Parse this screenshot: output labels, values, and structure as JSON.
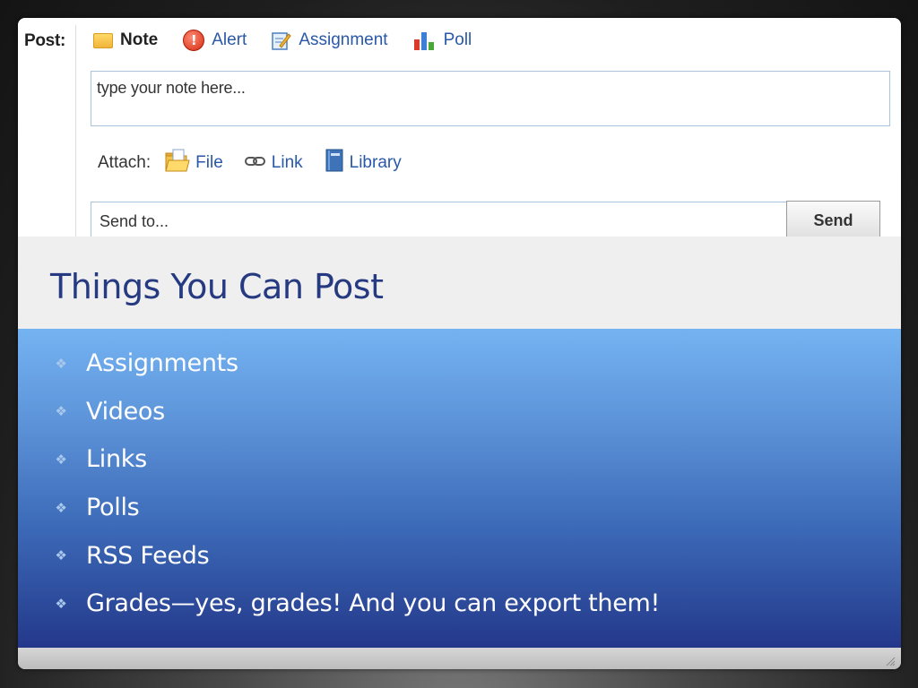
{
  "composer": {
    "post_label": "Post:",
    "types": [
      {
        "label": "Note",
        "icon": "note-icon"
      },
      {
        "label": "Alert",
        "icon": "alert-icon"
      },
      {
        "label": "Assignment",
        "icon": "assignment-icon"
      },
      {
        "label": "Poll",
        "icon": "poll-icon"
      }
    ],
    "active_type": "Note",
    "note_placeholder": "type your note here...",
    "attach_label": "Attach:",
    "attach": [
      {
        "label": "File",
        "icon": "folder-icon"
      },
      {
        "label": "Link",
        "icon": "chain-link-icon"
      },
      {
        "label": "Library",
        "icon": "book-icon"
      }
    ],
    "sendto_placeholder": "Send to...",
    "send_label": "Send"
  },
  "slide": {
    "title": "Things You Can Post",
    "bullets": [
      "Assignments",
      "Videos",
      "Links",
      "Polls",
      "RSS Feeds",
      "Grades—yes, grades! And you can export them!"
    ],
    "bullet_glyph": "❖"
  },
  "colors": {
    "title": "#253a80",
    "link": "#2a58a8",
    "content_top": "#74b3f2",
    "content_bottom": "#24388a"
  }
}
